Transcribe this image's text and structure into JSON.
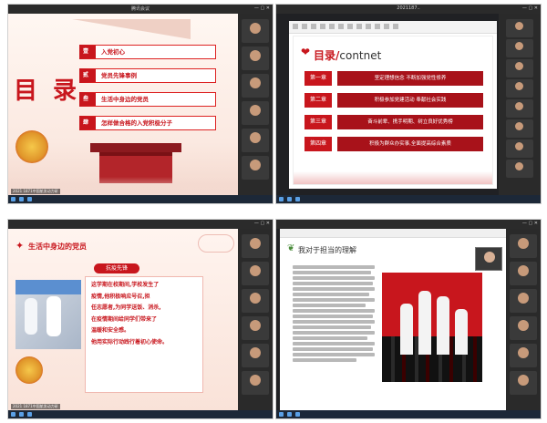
{
  "screens": [
    {
      "id": "top-left",
      "window_title": "腾讯会议",
      "caption": "2021 1871中国航发动力研",
      "slide": {
        "title": "目 录",
        "items": [
          {
            "num": "壹",
            "label": "入党初心"
          },
          {
            "num": "贰",
            "label": "党员先锋事例"
          },
          {
            "num": "叁",
            "label": "生活中身边的党员"
          },
          {
            "num": "肆",
            "label": "怎样做合格的入党积极分子"
          }
        ]
      },
      "participants": [
        "",
        "",
        "",
        "",
        "",
        ""
      ]
    },
    {
      "id": "top-right",
      "window_title": "2021187..",
      "caption": "",
      "slide": {
        "title_main": "目录/",
        "title_sub": "contnet",
        "rows": [
          {
            "label": "第一章",
            "text": "坚定理想信念 不断加强党性修养"
          },
          {
            "label": "第二章",
            "text": "积极参加党建活动 奉献社会实践"
          },
          {
            "label": "第三章",
            "text": "奋斗前辈、携手明期、树立良好优秀榜"
          },
          {
            "label": "第四章",
            "text": "积极为群众办实事,全面提高综合素质"
          }
        ]
      },
      "participants": [
        "",
        "",
        "",
        "",
        "",
        "",
        "",
        ""
      ]
    },
    {
      "id": "bottom-left",
      "window_title": "",
      "caption": "2021 1871中国航发动力研",
      "slide": {
        "title": "生活中身边的党员",
        "pill": "抗疫先锋",
        "paragraphs": [
          "这学期在校期间,学校发生了",
          "疫情,他积极响应号召,担",
          "任志愿者,为同学送饭、消杀,",
          "在疫情期间给同学们带来了",
          "温暖和安全感。",
          "他用实际行动践行着初心使命。"
        ]
      },
      "participants": [
        "",
        "",
        "",
        "",
        "",
        ""
      ]
    },
    {
      "id": "bottom-right",
      "window_title": "",
      "caption": "",
      "slide": {
        "title": "我对于担当的理解",
        "body_lines": 22
      },
      "participants": [
        "",
        "",
        "",
        "",
        "",
        ""
      ]
    }
  ],
  "colors": {
    "party_red": "#c8161d",
    "gold": "#f5c84a",
    "meeting_bg": "#202124"
  }
}
